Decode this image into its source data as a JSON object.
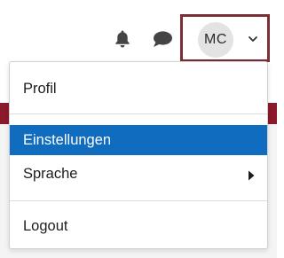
{
  "header": {
    "notifications_icon": "bell-icon",
    "messages_icon": "chat-icon",
    "user_initials": "MC",
    "toggle_icon": "chevron-down-icon"
  },
  "user_menu": {
    "items": [
      {
        "label": "Profil",
        "active": false
      },
      {
        "label": "Einstellungen",
        "active": true
      },
      {
        "label": "Sprache",
        "active": false,
        "has_submenu": true
      },
      {
        "label": "Logout",
        "active": false
      }
    ]
  },
  "colors": {
    "accent": "#0f6cbf",
    "toggle_border": "#7a2e36",
    "brand_band": "#8b1a2b"
  }
}
